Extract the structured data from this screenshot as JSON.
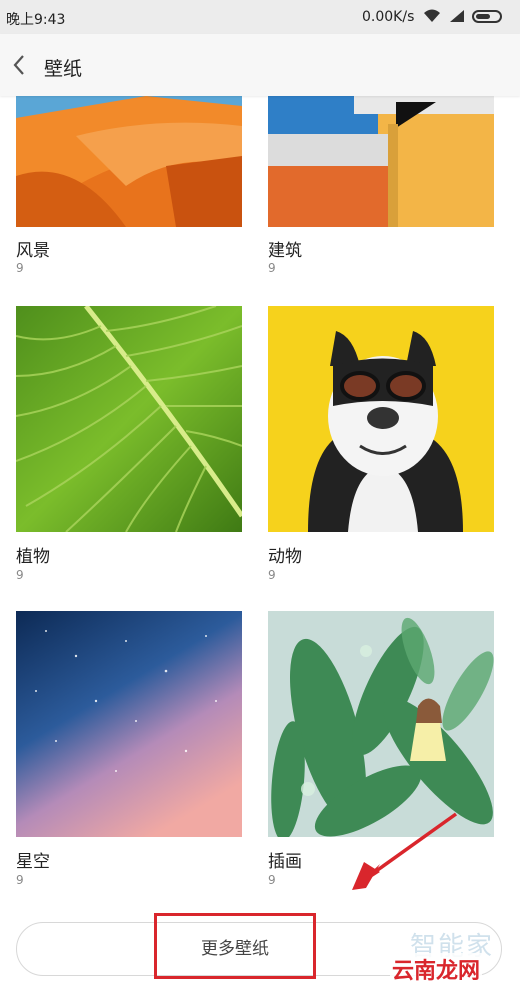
{
  "status_bar": {
    "time": "晚上9:43",
    "network_speed": "0.00K/s",
    "icons": [
      "wifi-icon",
      "signal-icon",
      "battery-icon"
    ]
  },
  "header": {
    "back_icon": "chevron-left-icon",
    "title": "壁纸"
  },
  "categories": [
    {
      "name": "风景",
      "count": "9",
      "thumbnail": "orange desert dunes under blue sky"
    },
    {
      "name": "建筑",
      "count": "9",
      "thumbnail": "yellow and orange building with blue sky"
    },
    {
      "name": "植物",
      "count": "9",
      "thumbnail": "green leaf close-up"
    },
    {
      "name": "动物",
      "count": "9",
      "thumbnail": "bulldog wearing goggles on yellow background"
    },
    {
      "name": "星空",
      "count": "9",
      "thumbnail": "starry night sky"
    },
    {
      "name": "插画",
      "count": "9",
      "thumbnail": "illustrated girl sitting on large leaves"
    }
  ],
  "more_button": {
    "label": "更多壁纸"
  },
  "watermarks": {
    "top": "智能家",
    "bottom": "云南龙网"
  },
  "colors": {
    "highlight": "#d9262c",
    "status_bg": "#ececec",
    "appbar_bg": "#f7f7f7"
  }
}
